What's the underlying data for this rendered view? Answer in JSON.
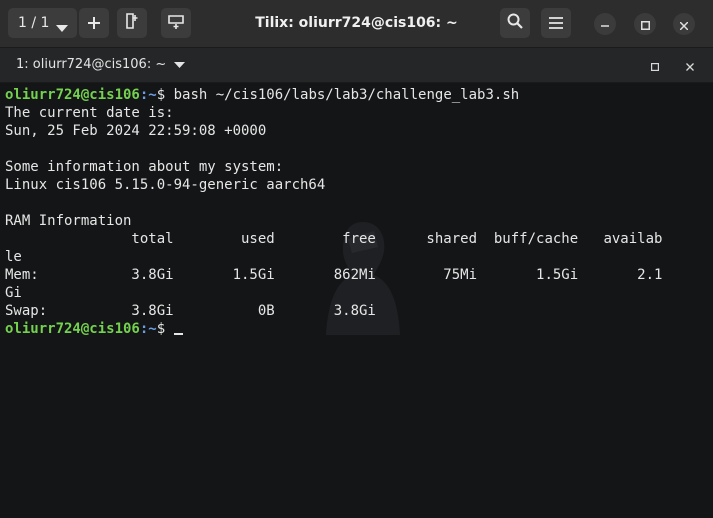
{
  "window": {
    "title": "Tilix: oliurr724@cis106: ~",
    "session_counter": "1 / 1"
  },
  "tab": {
    "title": "1: oliurr724@cis106: ~"
  },
  "terminal": {
    "prompt_user": "oliurr724@cis106",
    "prompt_sep": ":",
    "prompt_path": "~",
    "prompt_symbol": "$ ",
    "command": "bash ~/cis106/labs/lab3/challenge_lab3.sh",
    "output_lines": [
      "The current date is:",
      "Sun, 25 Feb 2024 22:59:08 +0000",
      "",
      "Some information about my system:",
      "Linux cis106 5.15.0-94-generic aarch64",
      "",
      "RAM Information",
      "               total        used        free      shared  buff/cache   availab",
      "le",
      "Mem:           3.8Gi       1.5Gi       862Mi        75Mi       1.5Gi       2.1",
      "Gi",
      "Swap:          3.8Gi          0B       3.8Gi"
    ]
  },
  "icons": {
    "session_dropdown": "chevron-down-icon",
    "add_terminal": "plus-icon",
    "split_right": "split-right-icon",
    "split_down": "split-down-icon",
    "search": "search-icon",
    "menu": "hamburger-menu-icon",
    "minimize": "minimize-icon",
    "maximize": "maximize-icon",
    "close": "close-icon",
    "tab_dropdown": "chevron-down-icon",
    "tab_maximize": "maximize-icon",
    "tab_close": "close-icon"
  },
  "colors": {
    "prompt_user": "#74d24e",
    "prompt_path": "#6b9fe5",
    "terminal_bg": "#141516",
    "titlebar_bg": "#2d2d2d"
  }
}
